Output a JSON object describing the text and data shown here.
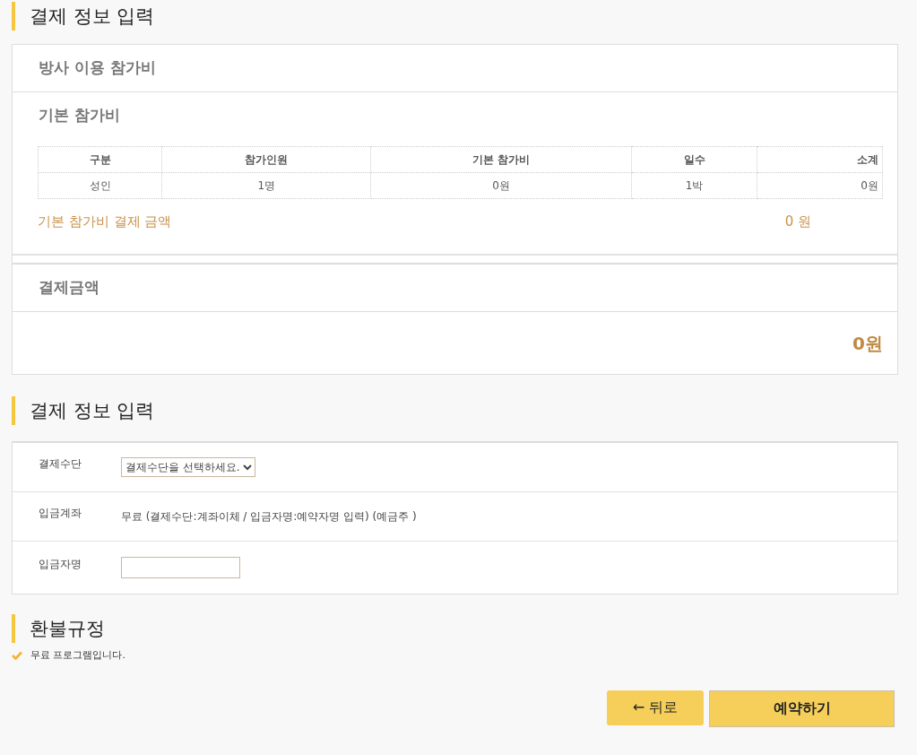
{
  "sections": [
    {
      "title": "결제 정보 입력"
    },
    {
      "title": "결제 정보 입력"
    },
    {
      "title": "환불규정"
    }
  ],
  "fee_panel": {
    "title": "방사 이용 참가비",
    "subtitle": "기본 참가비",
    "table": {
      "columns": [
        "구분",
        "참가인원",
        "기본 참가비",
        "일수",
        "소계"
      ],
      "rows": [
        [
          "성인",
          "1명",
          "0원",
          "1박",
          "0원"
        ]
      ]
    },
    "amount_label": "기본 참가비 결제 금액",
    "amount_value": "0 원"
  },
  "total_panel": {
    "title": "결제금액",
    "value": "0원"
  },
  "payment_form": [
    {
      "kind": "select",
      "label": "결제수단",
      "value": "결제수단을 선택하세요."
    },
    {
      "kind": "text",
      "label": "입금계좌",
      "value": "무료 (결제수단:계좌이체 / 입금자명:예약자명 입력) (예금주 )"
    },
    {
      "kind": "input",
      "label": "입금자명"
    }
  ],
  "refund_notes": [
    "무료 프로그램입니다."
  ],
  "buttons": [
    {
      "kind": "back",
      "label": "← 뒤로"
    },
    {
      "kind": "primary",
      "label": "예약하기"
    }
  ]
}
